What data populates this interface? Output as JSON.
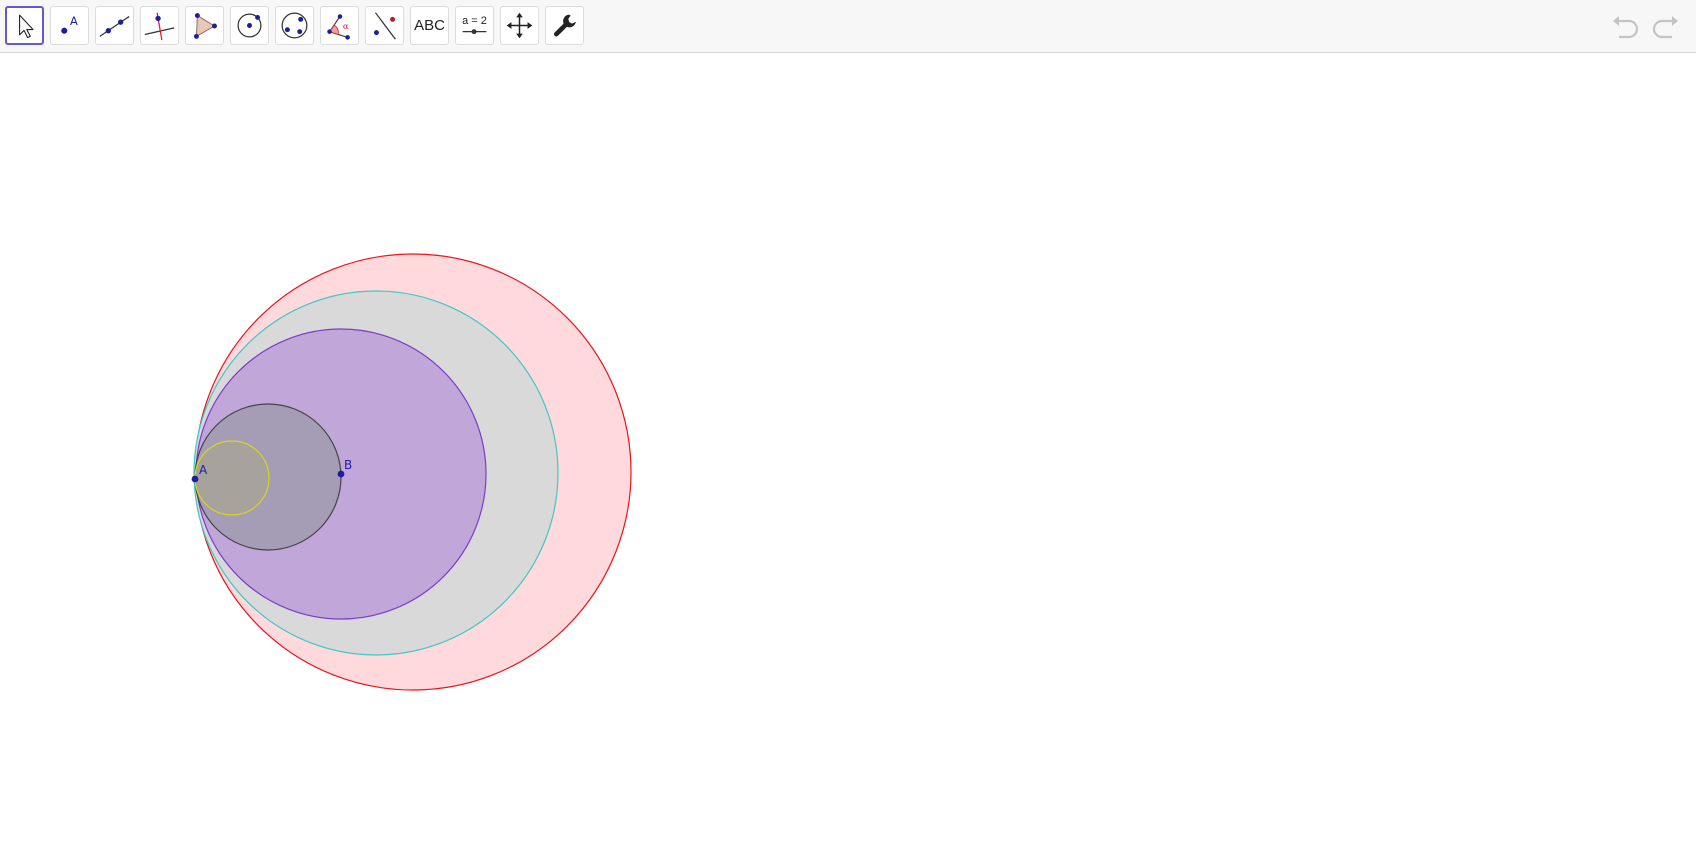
{
  "toolbar": {
    "tools": [
      {
        "name": "move-tool",
        "active": true
      },
      {
        "name": "point-tool",
        "glyph": "A"
      },
      {
        "name": "line-tool"
      },
      {
        "name": "perpendicular-line-tool"
      },
      {
        "name": "polygon-tool"
      },
      {
        "name": "circle-center-point-tool"
      },
      {
        "name": "circle-three-points-tool"
      },
      {
        "name": "angle-tool",
        "glyph": "α"
      },
      {
        "name": "reflect-tool"
      },
      {
        "name": "text-tool",
        "label": "ABC"
      },
      {
        "name": "slider-tool",
        "label": "a = 2"
      },
      {
        "name": "move-graphics-view-tool"
      },
      {
        "name": "settings-tool"
      }
    ],
    "undo": {
      "icon": "undo-icon",
      "enabled": false
    },
    "redo": {
      "icon": "redo-icon",
      "enabled": false
    }
  },
  "construction": {
    "points": [
      {
        "label": "A"
      },
      {
        "label": "B"
      }
    ],
    "circles": [
      {
        "name": "red-circle",
        "stroke": "#e8141e",
        "fill": "#ffd9dc"
      },
      {
        "name": "cyan-circle",
        "stroke": "#3fc8c8",
        "fill": "#d9d9d9"
      },
      {
        "name": "purple-circle",
        "stroke": "#7a3ec8",
        "fill": "#c1a7d9"
      },
      {
        "name": "gray-circle",
        "stroke": "#444444",
        "fill": "#a49db5"
      },
      {
        "name": "yellow-circle",
        "stroke": "#d8d420",
        "fill": "#a8a29d"
      }
    ],
    "point_color": "#1d1d9e"
  }
}
